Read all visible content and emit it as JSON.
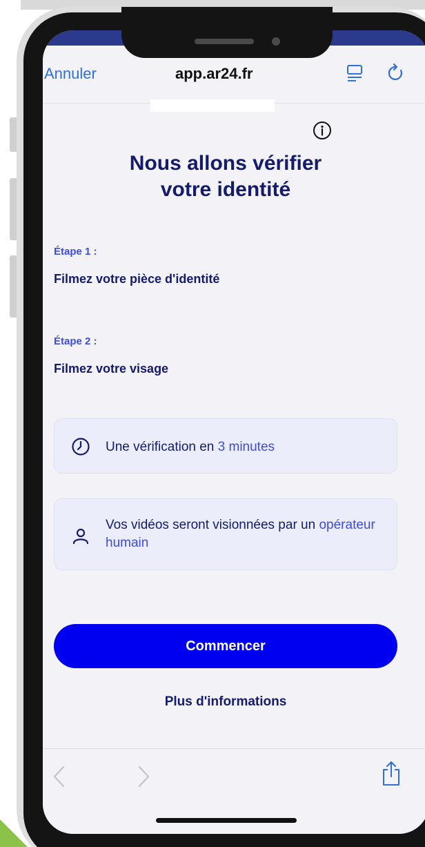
{
  "browser": {
    "cancel_label": "Annuler",
    "url": "app.ar24.fr",
    "reader_icon": "reader-icon",
    "reload_icon": "reload-icon"
  },
  "page": {
    "info_icon": "info-icon",
    "title_line1": "Nous allons vérifier",
    "title_line2": "votre identité",
    "steps": [
      {
        "label": "Étape 1 :",
        "text": "Filmez votre pièce d'identité"
      },
      {
        "label": "Étape 2 :",
        "text": "Filmez votre visage"
      }
    ],
    "card_duration": {
      "icon": "clock-icon",
      "text": "Une vérification en ",
      "highlight": "3 minutes"
    },
    "card_operator": {
      "icon": "user-icon",
      "text": "Vos vidéos seront visionnées par un ",
      "highlight": "opérateur humain"
    },
    "start_button": "Commencer",
    "more_info_link": "Plus d'informations"
  },
  "toolbar": {
    "back_icon": "back-chevron-icon",
    "forward_icon": "forward-chevron-icon",
    "share_icon": "share-icon"
  },
  "colors": {
    "primary": "#0000f0",
    "heading": "#141b6b",
    "accent": "#3d4cdc",
    "ios_link": "#2f6fd8",
    "card_bg": "#ebedfa"
  }
}
